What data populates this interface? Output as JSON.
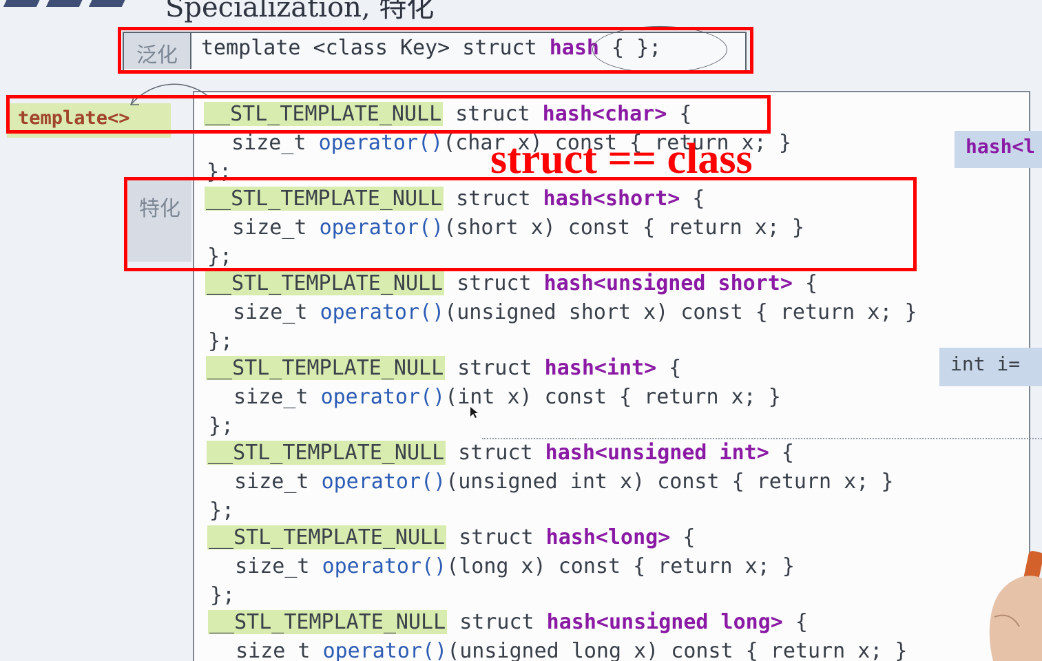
{
  "slide": {
    "title": "Specialization, 特化"
  },
  "generalization": {
    "label": "泛化",
    "code_prefix": "template <class Key> struct ",
    "code_name": "hash",
    "code_suffix": " { };"
  },
  "template_tag": "template<>",
  "specialization_label": "特化",
  "annotation": "struct == class",
  "callouts": {
    "hash": "hash<l",
    "int": "int i="
  },
  "code": {
    "macro": "__STL_TEMPLATE_NULL",
    "struct_kw": " struct ",
    "operator_pre": "  size_t ",
    "operator": "operator()",
    "close": "};",
    "lines": [
      {
        "name": "hash<char>",
        "brace": " {",
        "param": "(char x)",
        "body": " const { return x; }"
      },
      {
        "name": "hash<short>",
        "brace": " {",
        "param": "(short x)",
        "body": " const { return x; }"
      },
      {
        "name": "hash<unsigned short>",
        "brace": " {",
        "param": "(unsigned short x)",
        "body": " const { return x; }"
      },
      {
        "name": "hash<int>",
        "brace": " {",
        "param": "(int x)",
        "body": " const { return x; }"
      },
      {
        "name": "hash<unsigned int>",
        "brace": " {",
        "param": "(unsigned int x)",
        "body": " const { return x; }"
      },
      {
        "name": "hash<long>",
        "brace": " {",
        "param": "(long x)",
        "body": " const { return x; }"
      },
      {
        "name": "hash<unsigned long>",
        "brace": " {",
        "param": "(unsigned long x)",
        "body": " const { return x; }"
      }
    ]
  },
  "colors": {
    "annotation_red": "#ff0000",
    "keyword_purple": "#8a1aa4",
    "operator_blue": "#2d5cb4",
    "macro_highlight": "#d9ecb0"
  }
}
